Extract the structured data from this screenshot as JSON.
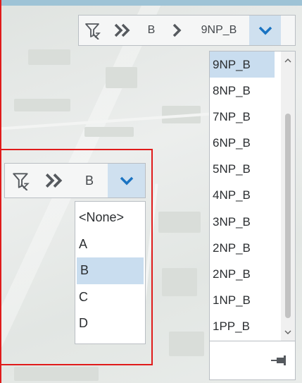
{
  "top_breadcrumb": {
    "filter_icon": "filter-icon",
    "chevrons_icon": "double-chevron-icon",
    "level1": "B",
    "separator_icon": "chevron-right-icon",
    "level2": "9NP_B",
    "dropdown_icon": "chevron-down-icon"
  },
  "top_list": {
    "options": [
      "9NP_B",
      "8NP_B",
      "7NP_B",
      "6NP_B",
      "5NP_B",
      "4NP_B",
      "3NP_B",
      "2NP_B",
      "2NP_B",
      "1NP_B",
      "1PP_B"
    ],
    "selected": "9NP_B",
    "pin_icon": "pin-icon"
  },
  "inner_breadcrumb": {
    "filter_icon": "filter-icon",
    "chevrons_icon": "double-chevron-icon",
    "level1": "B",
    "dropdown_icon": "chevron-down-icon"
  },
  "inner_list": {
    "options": [
      "<None>",
      "A",
      "B",
      "C",
      "D"
    ],
    "selected": "B"
  },
  "colors": {
    "frame": "#e01b1b",
    "selected_bg": "#c9ddef",
    "dropdown_button_bg": "#cfe0ef",
    "chevron_blue": "#1a73c2"
  }
}
